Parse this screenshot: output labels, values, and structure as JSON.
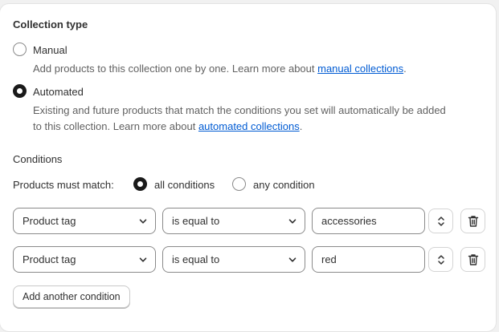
{
  "collection_type": {
    "heading": "Collection type",
    "manual": {
      "label": "Manual",
      "help_prefix": "Add products to this collection one by one. Learn more about ",
      "help_link": "manual collections",
      "help_suffix": ".",
      "checked": false
    },
    "automated": {
      "label": "Automated",
      "help_line1": "Existing and future products that match the conditions you set will automatically be added",
      "help_prefix2": "to this collection. Learn more about ",
      "help_link": "automated collections",
      "help_suffix": ".",
      "checked": true
    }
  },
  "conditions": {
    "heading": "Conditions",
    "match_label": "Products must match:",
    "options": [
      {
        "label": "all conditions",
        "checked": true
      },
      {
        "label": "any condition",
        "checked": false
      }
    ],
    "rows": [
      {
        "field": "Product tag",
        "operator": "is equal to",
        "value": "accessories"
      },
      {
        "field": "Product tag",
        "operator": "is equal to",
        "value": "red"
      }
    ],
    "add_button": "Add another condition"
  },
  "icons": {
    "chevron": "chevron-down-icon",
    "stepper": "selector-icon",
    "delete": "trash-icon"
  }
}
